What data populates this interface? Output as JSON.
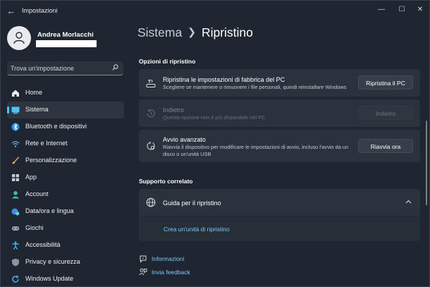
{
  "window": {
    "title": "Impostazioni",
    "controls": [
      "minimize-icon",
      "maximize-icon",
      "close-icon"
    ]
  },
  "user": {
    "name": "Andrea Morlacchi"
  },
  "search": {
    "placeholder": "Trova un'impostazione",
    "value": ""
  },
  "sidebar": {
    "items": [
      {
        "label": "Home",
        "icon": "home-icon"
      },
      {
        "label": "Sistema",
        "icon": "system-icon",
        "selected": true
      },
      {
        "label": "Bluetooth e dispositivi",
        "icon": "bluetooth-icon"
      },
      {
        "label": "Rete e Internet",
        "icon": "wifi-icon"
      },
      {
        "label": "Personalizzazione",
        "icon": "brush-icon"
      },
      {
        "label": "App",
        "icon": "apps-icon"
      },
      {
        "label": "Account",
        "icon": "account-icon"
      },
      {
        "label": "Data/ora e lingua",
        "icon": "globe-clock-icon"
      },
      {
        "label": "Giochi",
        "icon": "gamepad-icon"
      },
      {
        "label": "Accessibilità",
        "icon": "accessibility-icon"
      },
      {
        "label": "Privacy e sicurezza",
        "icon": "shield-icon"
      },
      {
        "label": "Windows Update",
        "icon": "update-icon"
      }
    ]
  },
  "breadcrumb": {
    "parent": "Sistema",
    "current": "Ripristino"
  },
  "recovery": {
    "section_title": "Opzioni di ripristino",
    "options": [
      {
        "title": "Ripristina le impostazioni di fabbrica del PC",
        "description": "Scegliere se mantenere o rimuovere i file personali, quindi reinstallare Windows",
        "button": "Ripristina il PC",
        "enabled": true
      },
      {
        "title": "Indietro",
        "description": "Questa opzione non è più disponibile nel PC",
        "button": "Indietro",
        "enabled": false
      },
      {
        "title": "Avvio avanzato",
        "description": "Riavvia il dispositivo per modificare le impostazioni di avvio, incluso l'avvio da un disco o un'unità USB",
        "button": "Riavvia ora",
        "enabled": true
      }
    ]
  },
  "related": {
    "section_title": "Supporto correlato",
    "help_title": "Guida per il ripristino",
    "help_link": "Crea un'unità di ripristino"
  },
  "footer": {
    "info_link": "Informazioni",
    "feedback_link": "Invia feedback"
  },
  "colors": {
    "accent": "#4cc2ff",
    "link": "#7fc8f8"
  }
}
